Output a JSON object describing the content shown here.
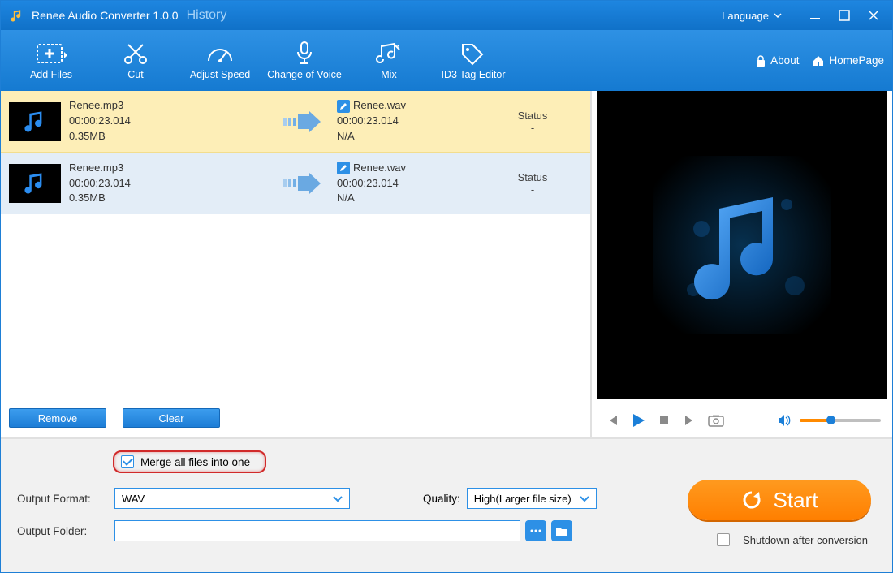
{
  "titlebar": {
    "title": "Renee Audio Converter 1.0.0",
    "history": "History",
    "language": "Language"
  },
  "toolbar": {
    "addfiles": "Add Files",
    "cut": "Cut",
    "adjustspeed": "Adjust Speed",
    "changevoice": "Change of Voice",
    "mix": "Mix",
    "id3": "ID3 Tag Editor",
    "about": "About",
    "homepage": "HomePage"
  },
  "files": [
    {
      "src_name": "Renee.mp3",
      "src_dur": "00:00:23.014",
      "src_size": "0.35MB",
      "dst_name": "Renee.wav",
      "dst_dur": "00:00:23.014",
      "dst_size": "N/A",
      "status_label": "Status",
      "status_value": "-"
    },
    {
      "src_name": "Renee.mp3",
      "src_dur": "00:00:23.014",
      "src_size": "0.35MB",
      "dst_name": "Renee.wav",
      "dst_dur": "00:00:23.014",
      "dst_size": "N/A",
      "status_label": "Status",
      "status_value": "-"
    }
  ],
  "actions": {
    "remove": "Remove",
    "clear": "Clear"
  },
  "bottom": {
    "merge": "Merge all files into one",
    "output_format_label": "Output Format:",
    "output_format_value": "WAV",
    "quality_label": "Quality:",
    "quality_value": "High(Larger file size)",
    "output_folder_label": "Output Folder:",
    "output_folder_value": "",
    "start": "Start",
    "shutdown": "Shutdown after conversion"
  }
}
